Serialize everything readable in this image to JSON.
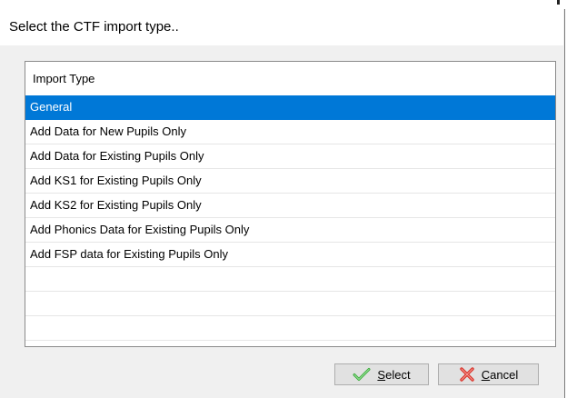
{
  "dialog": {
    "title": "Select the CTF import type.."
  },
  "list": {
    "header": "Import Type",
    "items": [
      {
        "label": "General",
        "selected": true
      },
      {
        "label": "Add Data for New Pupils Only",
        "selected": false
      },
      {
        "label": "Add Data for Existing Pupils Only",
        "selected": false
      },
      {
        "label": "Add KS1 for Existing Pupils Only",
        "selected": false
      },
      {
        "label": "Add KS2 for Existing Pupils Only",
        "selected": false
      },
      {
        "label": "Add Phonics Data for Existing Pupils Only",
        "selected": false
      },
      {
        "label": "Add FSP data for Existing Pupils Only",
        "selected": false
      }
    ],
    "empty_rows": 4,
    "selection_color": "#0078d7"
  },
  "buttons": {
    "select": {
      "mnemonic": "S",
      "rest": "elect",
      "icon": "checkmark-icon",
      "icon_color": "#3cab3c"
    },
    "cancel": {
      "mnemonic": "C",
      "rest": "ancel",
      "icon": "red-x-icon",
      "icon_color": "#d9342b"
    }
  }
}
